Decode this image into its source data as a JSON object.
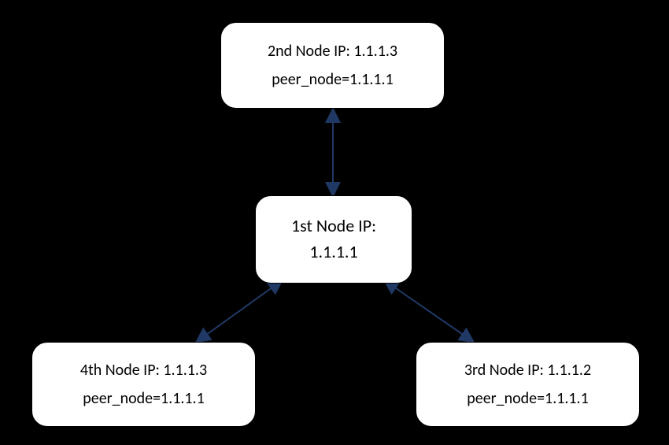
{
  "nodes": {
    "top": {
      "line1": "2nd Node IP: 1.1.1.3",
      "line2": "peer_node=1.1.1.1"
    },
    "center": {
      "line1": "1st  Node IP:",
      "line2": "1.1.1.1"
    },
    "bottom_left": {
      "line1": "4th Node IP: 1.1.1.3",
      "line2": "peer_node=1.1.1.1"
    },
    "bottom_right": {
      "line1": "3rd Node IP: 1.1.1.2",
      "line2": "peer_node=1.1.1.1"
    }
  },
  "edges": [
    {
      "from": "center",
      "to": "top",
      "bidirectional": true
    },
    {
      "from": "center",
      "to": "bottom_left",
      "bidirectional": true
    },
    {
      "from": "center",
      "to": "bottom_right",
      "bidirectional": true
    }
  ],
  "colors": {
    "arrow": "#1f3864",
    "box_fill": "#ffffff",
    "box_border": "#000000",
    "background": "#000000"
  }
}
